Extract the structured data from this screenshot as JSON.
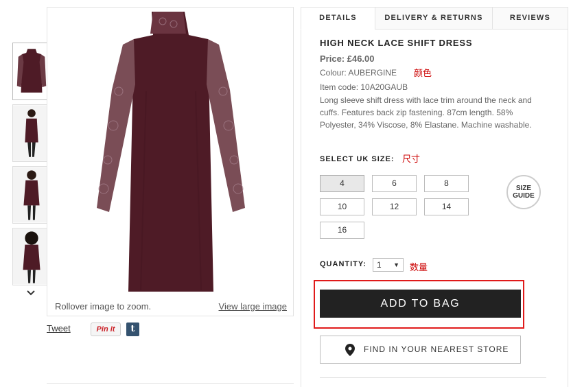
{
  "gallery": {
    "thumbnails": [
      {
        "label": "thumbnail 1",
        "active": true
      },
      {
        "label": "thumbnail 2",
        "active": false
      },
      {
        "label": "thumbnail 3",
        "active": false
      },
      {
        "label": "thumbnail 4",
        "active": false
      }
    ],
    "scroll_icon": "chevron-down-icon",
    "zoom_hint": "Rollover image to zoom.",
    "view_large": "View large image"
  },
  "share": {
    "tweet": "Tweet",
    "pinit": "Pin it",
    "tumblr": "t"
  },
  "tabs": [
    {
      "label": "DETAILS",
      "active": true
    },
    {
      "label": "DELIVERY & RETURNS",
      "active": false
    },
    {
      "label": "REVIEWS",
      "active": false
    }
  ],
  "product": {
    "title": "HIGH NECK LACE SHIFT DRESS",
    "price": "Price: £46.00",
    "colour": "Colour: AUBERGINE",
    "item_code": "Item code: 10A20GAUB",
    "description": "Long sleeve shift dress with lace trim around the neck and cuffs. Features back zip fastening. 87cm length. 58% Polyester, 34% Viscose, 8% Elastane. Machine washable."
  },
  "annotations": {
    "colour": "颜色",
    "size": "尺寸",
    "quantity": "数量"
  },
  "size": {
    "label": "SELECT UK SIZE:",
    "options": [
      "4",
      "6",
      "8",
      "10",
      "12",
      "14",
      "16"
    ],
    "selected": "4",
    "guide_line1": "SIZE",
    "guide_line2": "GUIDE"
  },
  "quantity": {
    "label": "QUANTITY:",
    "value": "1",
    "caret": "▼"
  },
  "actions": {
    "add_to_bag": "ADD TO BAG",
    "find_store": "FIND IN YOUR NEAREST STORE",
    "find_store_icon": "map-pin-icon"
  },
  "colors": {
    "dress": "#4e1b26",
    "highlight": "#e01a1a",
    "button_dark": "#222222",
    "annotation": "#cc0000"
  }
}
